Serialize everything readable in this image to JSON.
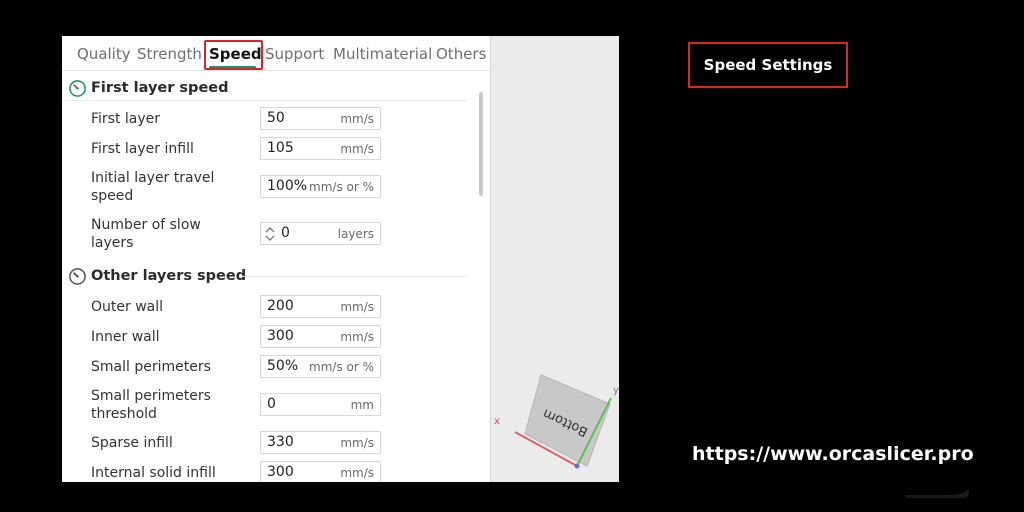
{
  "tabs": [
    {
      "label": "Quality",
      "active": false
    },
    {
      "label": "Strength",
      "active": false
    },
    {
      "label": "Speed",
      "active": true
    },
    {
      "label": "Support",
      "active": false
    },
    {
      "label": "Multimaterial",
      "active": false
    },
    {
      "label": "Others",
      "active": false
    }
  ],
  "sections": {
    "first_layer": {
      "title": "First layer speed",
      "rows": [
        {
          "label": "First layer",
          "value": "50",
          "unit": "mm/s"
        },
        {
          "label": "First layer infill",
          "value": "105",
          "unit": "mm/s"
        },
        {
          "label": "Initial layer travel speed",
          "value": "100%",
          "unit": "mm/s or %"
        },
        {
          "label": "Number of slow layers",
          "value": "0",
          "unit": "layers"
        }
      ]
    },
    "other_layers": {
      "title": "Other layers speed",
      "rows": [
        {
          "label": "Outer wall",
          "value": "200",
          "unit": "mm/s"
        },
        {
          "label": "Inner wall",
          "value": "300",
          "unit": "mm/s"
        },
        {
          "label": "Small perimeters",
          "value": "50%",
          "unit": "mm/s or %"
        },
        {
          "label": "Small perimeters threshold",
          "value": "0",
          "unit": "mm"
        },
        {
          "label": "Sparse infill",
          "value": "330",
          "unit": "mm/s"
        },
        {
          "label": "Internal solid infill",
          "value": "300",
          "unit": "mm/s"
        }
      ]
    }
  },
  "viewport": {
    "cube_face": "Bottom",
    "axis_x": "x",
    "axis_y": "y"
  },
  "callout": {
    "label": "Speed Settings"
  },
  "footer": {
    "url": "https://www.orcaslicer.pro"
  },
  "colors": {
    "highlight": "#d8262b",
    "tab_accent": "#1a8f72",
    "background": "#000000",
    "panel": "#ffffff"
  }
}
